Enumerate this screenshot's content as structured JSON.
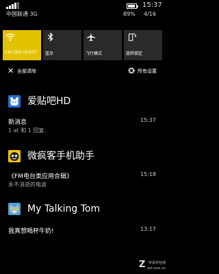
{
  "status_bar": {
    "carrier": "中国联通 3G",
    "time": "15:37",
    "battery_percent": "89%",
    "date": "4/16",
    "battery_level": 0.89
  },
  "quick_actions": [
    {
      "label": "CN-CBSI-GUEST",
      "icon": "wifi-icon",
      "active": true
    },
    {
      "label": "蓝牙",
      "icon": "bluetooth-icon",
      "active": false
    },
    {
      "label": "飞行模式",
      "icon": "airplane-icon",
      "active": false
    },
    {
      "label": "旋转锁定",
      "icon": "rotation-lock-icon",
      "active": false
    }
  ],
  "action_bar": {
    "clear_all": "全部清除",
    "all_settings": "所有设置"
  },
  "notifications": [
    {
      "app": "爱贴吧HD",
      "icon": "tieba-icon",
      "title": "新消息",
      "subtitle": "1 at 和 1 回复.",
      "time": "15:37"
    },
    {
      "app": "微疯客手机助手",
      "icon": "weifengke-icon",
      "title": "《FM电台类应用合辑》",
      "subtitle": "永不消逝的电波",
      "time": "15:18"
    },
    {
      "app": "My Talking Tom",
      "icon": "talking-tom-icon",
      "title": "我真想喝杯牛奶!",
      "subtitle": "",
      "time": "13:17"
    }
  ],
  "watermark": {
    "logo": "Z",
    "line1": "中关村在线",
    "line2": "zol.com.cn"
  },
  "colors": {
    "accent": "#e3c300",
    "tile": "#2a2a2a",
    "background": "#000000"
  }
}
